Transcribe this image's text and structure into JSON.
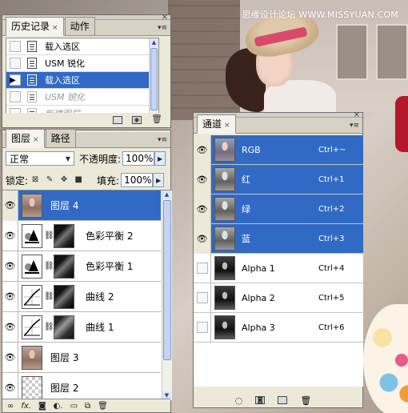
{
  "watermark": "思缘设计论坛 WWW.MISSYUAN.COM",
  "history_panel": {
    "tabs": [
      "历史记录",
      "动作"
    ],
    "items": [
      {
        "label": "载入选区",
        "state": "normal"
      },
      {
        "label": "USM 锐化",
        "state": "normal"
      },
      {
        "label": "载入选区",
        "state": "selected"
      },
      {
        "label": "USM 锐化",
        "state": "undone"
      },
      {
        "label": "新建图层",
        "state": "undone"
      }
    ]
  },
  "layers_panel": {
    "tabs": [
      "图层",
      "路径"
    ],
    "blend_mode": "正常",
    "opacity_label": "不透明度:",
    "opacity_value": "100%",
    "lock_label": "锁定:",
    "fill_label": "填充:",
    "fill_value": "100%",
    "layers": [
      {
        "name": "图层 4",
        "kind": "image",
        "selected": true
      },
      {
        "name": "色彩平衡 2",
        "kind": "color-balance",
        "selected": false
      },
      {
        "name": "色彩平衡 1",
        "kind": "color-balance",
        "selected": false
      },
      {
        "name": "曲线 2",
        "kind": "curves",
        "selected": false
      },
      {
        "name": "曲线 1",
        "kind": "curves",
        "selected": false
      },
      {
        "name": "图层 3",
        "kind": "image",
        "selected": false
      },
      {
        "name": "图层 2",
        "kind": "transparent",
        "selected": false
      }
    ],
    "footer_icons": [
      "link-icon",
      "fx-icon",
      "mask-icon",
      "adjustment-icon",
      "folder-icon",
      "new-layer-icon",
      "trash-icon"
    ]
  },
  "channels_panel": {
    "tabs": [
      "通道"
    ],
    "channels": [
      {
        "name": "RGB",
        "shortcut": "Ctrl+~",
        "selected": true,
        "visible": true,
        "thumb": "rgb"
      },
      {
        "name": "红",
        "shortcut": "Ctrl+1",
        "selected": true,
        "visible": true,
        "thumb": "gray"
      },
      {
        "name": "绿",
        "shortcut": "Ctrl+2",
        "selected": true,
        "visible": true,
        "thumb": "gray"
      },
      {
        "name": "蓝",
        "shortcut": "Ctrl+3",
        "selected": true,
        "visible": true,
        "thumb": "gray"
      },
      {
        "name": "Alpha 1",
        "shortcut": "Ctrl+4",
        "selected": false,
        "visible": false,
        "thumb": "dark"
      },
      {
        "name": "Alpha 2",
        "shortcut": "Ctrl+5",
        "selected": false,
        "visible": false,
        "thumb": "dark"
      },
      {
        "name": "Alpha 3",
        "shortcut": "Ctrl+6",
        "selected": false,
        "visible": false,
        "thumb": "dark"
      }
    ],
    "footer_icons": [
      "load-selection-icon",
      "save-selection-icon",
      "new-channel-icon",
      "trash-icon"
    ]
  },
  "colors": {
    "selection": "#316ac5",
    "panel_bg": "#ece9d8"
  }
}
